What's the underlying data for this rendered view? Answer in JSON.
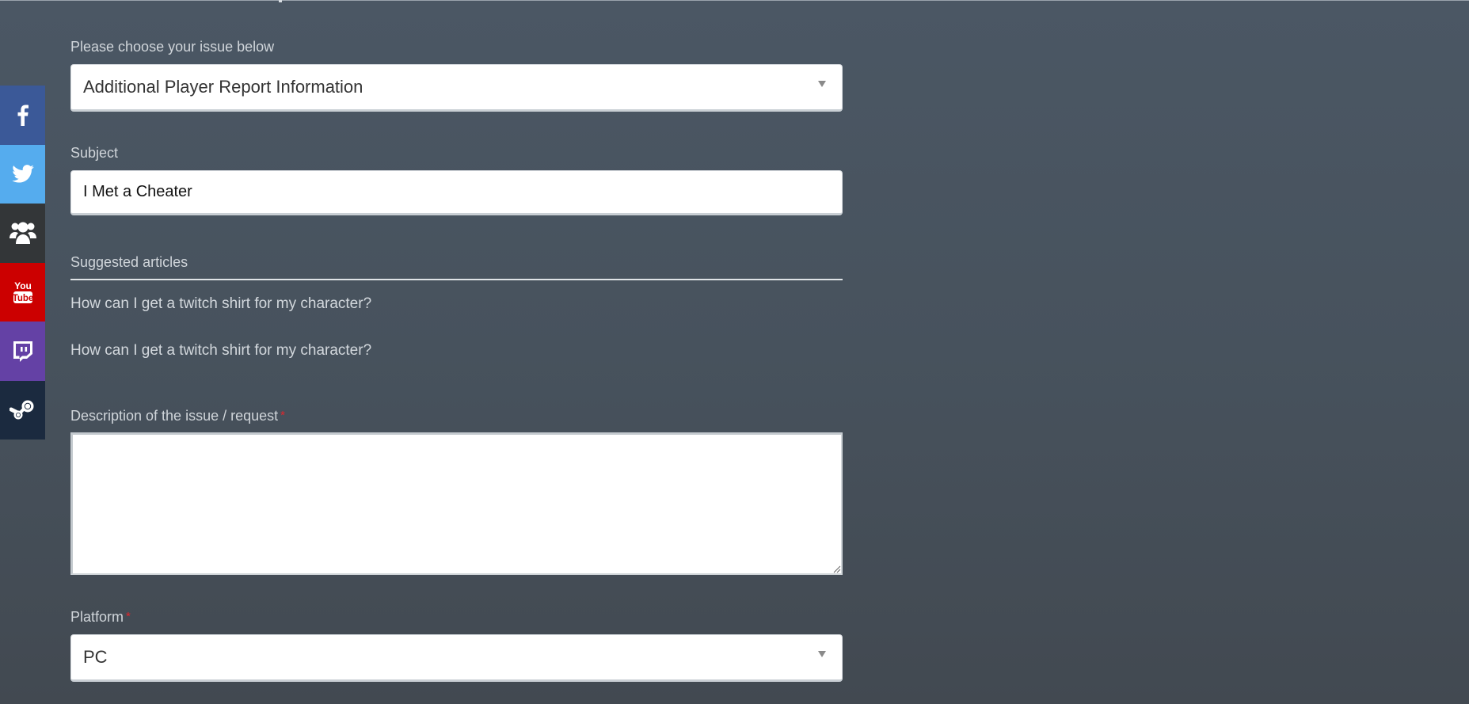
{
  "social": {
    "items": [
      {
        "name": "facebook",
        "icon": "facebook-icon",
        "color": "#3b5998"
      },
      {
        "name": "twitter",
        "icon": "twitter-icon",
        "color": "#55acee"
      },
      {
        "name": "community",
        "icon": "community-icon",
        "color": "#333638"
      },
      {
        "name": "youtube",
        "icon": "youtube-icon",
        "color": "#cc0000"
      },
      {
        "name": "twitch",
        "icon": "twitch-icon",
        "color": "#6441a5"
      },
      {
        "name": "steam",
        "icon": "steam-icon",
        "color": "#1b2a3f"
      }
    ]
  },
  "form": {
    "issue": {
      "label": "Please choose your issue below",
      "selected": "Additional Player Report Information"
    },
    "subject": {
      "label": "Subject",
      "value": "I Met a Cheater"
    },
    "suggested": {
      "heading": "Suggested articles",
      "articles": [
        "How can I get a twitch shirt for my character?",
        "How can I get a twitch shirt for my character?"
      ]
    },
    "description": {
      "label": "Description of the issue / request",
      "required_mark": "*",
      "value": ""
    },
    "platform": {
      "label": "Platform",
      "required_mark": "*",
      "selected": "PC"
    }
  },
  "colors": {
    "required": "#e0262c",
    "label_text": "#d0d5da"
  }
}
